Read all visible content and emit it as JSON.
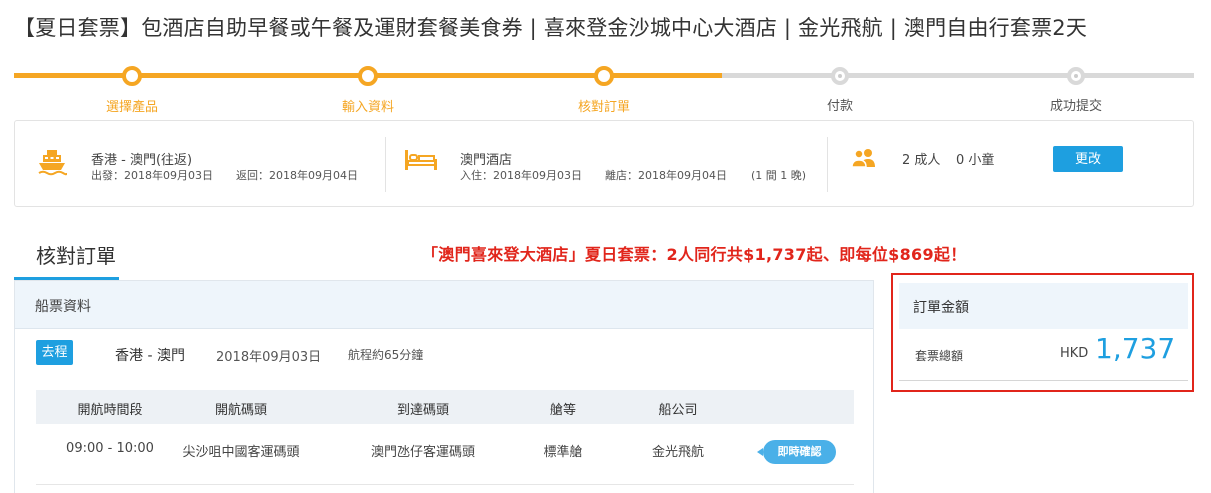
{
  "page": {
    "title": "【夏日套票】包酒店自助早餐或午餐及運財套餐美食券 | 喜來登金沙城中心大酒店 | 金光飛航 | 澳門自由行套票2天"
  },
  "progress": {
    "completed_fraction": 0.5,
    "steps": [
      {
        "label": "選擇產品",
        "state": "done"
      },
      {
        "label": "輸入資料",
        "state": "done"
      },
      {
        "label": "核對訂單",
        "state": "current"
      },
      {
        "label": "付款",
        "state": "pending"
      },
      {
        "label": "成功提交",
        "state": "pending"
      }
    ]
  },
  "summary": {
    "ferry": {
      "icon": "ferry-icon",
      "route": "香港 - 澳門(往返)",
      "depart": "出發：2018年09月03日",
      "return": "返回：2018年09月04日"
    },
    "hotel": {
      "icon": "bed-icon",
      "name": "澳門酒店",
      "checkin": "入住：2018年09月03日",
      "checkout": "離店：2018年09月04日",
      "rooms": "(1 間 1 晚)"
    },
    "guests": {
      "icon": "people-icon",
      "adults": "2 成人",
      "children": "0 小童"
    },
    "change_label": "更改"
  },
  "check_order": {
    "title": "核對訂單",
    "promo": "「澳門喜來登大酒店」夏日套票：2人同行共$1,737起、即每位$869起！"
  },
  "ticket": {
    "section_title": "船票資料",
    "direction": "去程",
    "route": "香港 - 澳門",
    "date": "2018年09月03日",
    "duration": "航程約65分鐘",
    "columns": [
      "開航時間段",
      "開航碼頭",
      "到達碼頭",
      "艙等",
      "船公司"
    ],
    "rows": [
      [
        "09:00 - 10:00",
        "尖沙咀中國客運碼頭",
        "澳門氹仔客運碼頭",
        "標準艙",
        "金光飛航"
      ]
    ],
    "confirm_tag": "即時確認"
  },
  "order": {
    "title": "訂單金額",
    "total_label": "套票總額",
    "currency": "HKD",
    "amount": "1,737"
  },
  "colors": {
    "accent_orange": "#f5a623",
    "primary_blue": "#1e9fe0",
    "promo_red": "#e1251b"
  }
}
